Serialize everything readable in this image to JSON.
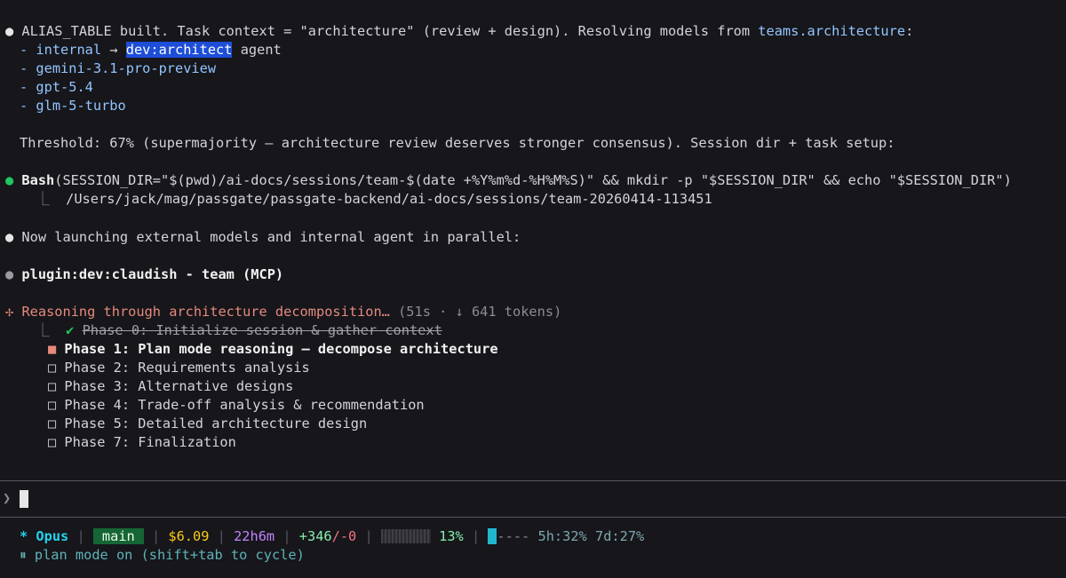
{
  "messages": {
    "alias": {
      "text": "ALIAS_TABLE built. Task context = \"architecture\" (review + design). Resolving models from ",
      "link": "teams.architecture",
      "suffix": ":",
      "items": [
        {
          "prefix": "- ",
          "name": "internal",
          "arrow": " → ",
          "highlight": "dev:architect",
          "rest": " agent"
        },
        {
          "prefix": "- ",
          "name": "gemini-3.1-pro-preview"
        },
        {
          "prefix": "- ",
          "name": "gpt-5.4"
        },
        {
          "prefix": "- ",
          "name": "glm-5-turbo"
        }
      ],
      "threshold": "Threshold: 67% (supermajority — architecture review deserves stronger consensus). Session dir + task setup:"
    },
    "bash": {
      "tool": "Bash",
      "command": "(SESSION_DIR=\"$(pwd)/ai-docs/sessions/team-$(date +%Y%m%d-%H%M%S)\" && mkdir -p \"$SESSION_DIR\" && echo \"$SESSION_DIR\")",
      "output": "/Users/jack/mag/passgate/passgate-backend/ai-docs/sessions/team-20260414-113451"
    },
    "launching": "Now launching external models and internal agent in parallel:",
    "plugin": "plugin:dev:claudish - team (MCP)"
  },
  "spinner": {
    "glyph": "✢",
    "label": "Reasoning through architecture decomposition…",
    "meta": " (51s · ↓ 641 tokens)"
  },
  "tasks": [
    {
      "label": "Phase 0: Initialize session & gather context",
      "status": "done"
    },
    {
      "label": "Phase 1: Plan mode reasoning — decompose architecture",
      "status": "active"
    },
    {
      "label": "Phase 2: Requirements analysis",
      "status": "pending"
    },
    {
      "label": "Phase 3: Alternative designs",
      "status": "pending"
    },
    {
      "label": "Phase 4: Trade-off analysis & recommendation",
      "status": "pending"
    },
    {
      "label": "Phase 5: Detailed architecture design",
      "status": "pending"
    },
    {
      "label": "Phase 7: Finalization",
      "status": "pending"
    }
  ],
  "prompt": {
    "char": "❯",
    "value": ""
  },
  "statusline": {
    "model": "* Opus",
    "branch": "main",
    "cost": "$6.09",
    "duration": "22h6m",
    "added": "+346",
    "removed": "/-0",
    "context_pct": "13%",
    "usage_dashes": "----",
    "limit_5h_label": "5h:",
    "limit_5h": "32%",
    "limit_7d_label": "7d:",
    "limit_7d": "27%"
  },
  "mode": {
    "icon": "⏸",
    "text": "plan mode on (shift+tab to cycle)"
  },
  "colors": {
    "background": "#16161b",
    "accent_blue": "#93c5fd",
    "highlight": "#1d4ed8",
    "success": "#22c55e",
    "spinner": "#e58a7c"
  }
}
